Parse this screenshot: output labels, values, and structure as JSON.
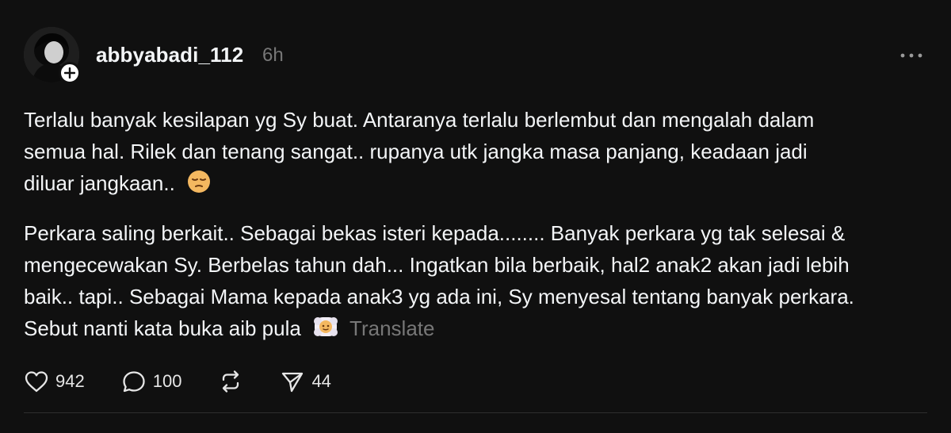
{
  "post": {
    "username": "abbyabadi_112",
    "time": "6h",
    "paragraph1": [
      "Terlalu banyak kesilapan yg Sy buat. Antaranya terlalu berlembut dan mengalah dalam",
      "semua hal. Rilek dan tenang sangat.. rupanya utk jangka masa panjang, keadaan jadi",
      "diluar jangkaan.. "
    ],
    "paragraph1_emoji": "pensive-face-emoji",
    "paragraph2": [
      "Perkara saling berkait.. Sebagai bekas isteri kepada........ Banyak perkara yg tak selesai &",
      "mengecewakan Sy. Berbelas tahun dah... Ingatkan bila berbaik, hal2 anak2 akan jadi lebih",
      "baik.. tapi.. Sebagai Mama kepada anak3 yg ada ini, Sy menyesal tentang banyak perkara.",
      "Sebut nanti kata buka aib pula "
    ],
    "paragraph2_emoji": "face-in-clouds-emoji",
    "translate_label": "Translate"
  },
  "actions": {
    "likes": "942",
    "replies": "100",
    "shares": "44",
    "like_icon": "heart-icon",
    "reply_icon": "comment-bubble-icon",
    "repost_icon": "repost-icon",
    "share_icon": "send-icon"
  },
  "colors": {
    "background": "#101010",
    "text": "#f3f5f7",
    "muted": "#777777",
    "divider": "#2e2e2e"
  }
}
